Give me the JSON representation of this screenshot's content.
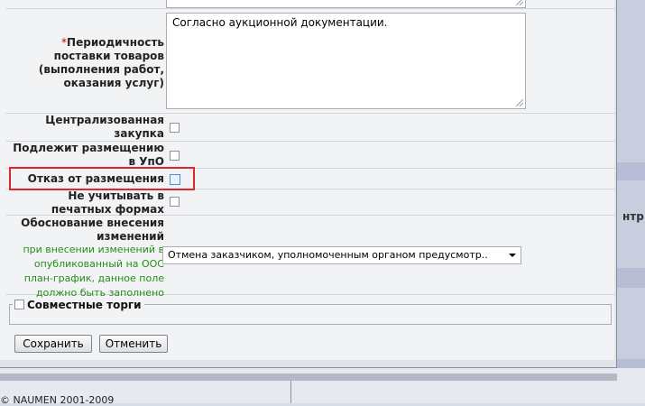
{
  "form": {
    "periodicity": {
      "required_mark": "*",
      "label_lines": [
        "Периодичность",
        "поставки товаров",
        "(выполнения работ,",
        "оказания услуг)"
      ],
      "value": "Согласно аукционной документации."
    },
    "centralized": {
      "label_lines": [
        "Централизованная",
        "закупка"
      ],
      "checked": false
    },
    "upo": {
      "label_lines": [
        "Подлежит размещению",
        "в УпО"
      ],
      "checked": false
    },
    "refusal": {
      "label": "Отказ от размещения",
      "checked": false
    },
    "no_print": {
      "label_lines": [
        "Не учитывать в",
        "печатных формах"
      ],
      "checked": false
    },
    "justification": {
      "label_lines": [
        "Обоснование внесения",
        "изменений"
      ],
      "hint_lines": [
        "при внесении изменений в",
        "опубликованный на ООС",
        "план-график, данное поле",
        "должно быть заполнено"
      ],
      "selected": "Отмена заказчиком, уполномоченным органом предусмотр.."
    },
    "joint": {
      "label": "Совместные торги",
      "checked": false
    }
  },
  "buttons": {
    "save": "Сохранить",
    "cancel": "Отменить"
  },
  "background": {
    "right_text": "нтр",
    "copyright": "© NAUMEN 2001-2009"
  }
}
